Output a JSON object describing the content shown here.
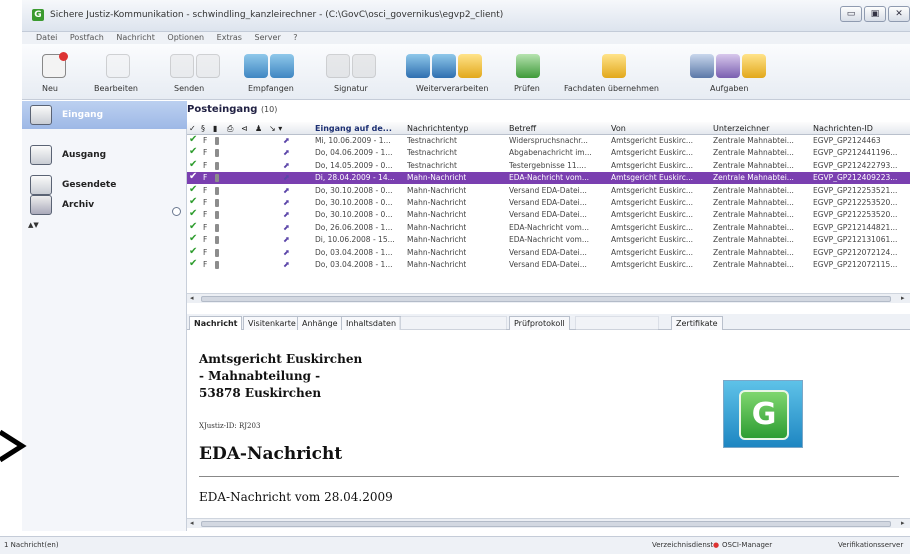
{
  "window": {
    "title": "Sichere Justiz-Kommunikation - schwindling_kanzleirechner - (C:\\GovC\\osci_governikus\\egvp2_client)",
    "buttons": [
      "▭",
      "▣",
      "✕"
    ]
  },
  "menu": [
    "Datei",
    "Postfach",
    "Nachricht",
    "Optionen",
    "Extras",
    "Server",
    "?"
  ],
  "toolbar": {
    "neu": "Neu",
    "bearbeiten": "Bearbeiten",
    "senden": "Senden",
    "empfangen": "Empfangen",
    "signatur": "Signatur",
    "weiterverarbeiten": "Weiterverarbeiten",
    "pruefen": "Prüfen",
    "fachdaten": "Fachdaten übernehmen",
    "aufgaben": "Aufgaben"
  },
  "sidebar": {
    "items": [
      {
        "label": "Eingang"
      },
      {
        "label": "Ausgang"
      },
      {
        "label": "Gesendete"
      },
      {
        "label": "Archiv"
      }
    ],
    "collapse": "▲▼"
  },
  "list": {
    "title": "Posteingang",
    "count": "(10)",
    "columns": {
      "flags": "§",
      "eingang": "Eingang auf de...",
      "typ": "Nachrichtentyp",
      "betreff": "Betreff",
      "von": "Von",
      "unterzeichner": "Unterzeichner",
      "id": "Nachrichten-ID"
    },
    "rows": [
      {
        "f": "F",
        "date": "Mi, 10.06.2009 - 1...",
        "typ": "Testnachricht",
        "betreff": "Widerspruchsnachr...",
        "von": "Amtsgericht Euskirc...",
        "unter": "Zentrale Mahnabtei...",
        "id": "EGVP_GP2124463"
      },
      {
        "f": "F",
        "date": "Do, 04.06.2009 - 1...",
        "typ": "Testnachricht",
        "betreff": "Abgabenachricht im...",
        "von": "Amtsgericht Euskirc...",
        "unter": "Zentrale Mahnabtei...",
        "id": "EGVP_GP212441196..."
      },
      {
        "f": "F",
        "date": "Do, 14.05.2009 - 0...",
        "typ": "Testnachricht",
        "betreff": "Testergebnisse 11....",
        "von": "Amtsgericht Euskirc...",
        "unter": "Zentrale Mahnabtei...",
        "id": "EGVP_GP212422793..."
      },
      {
        "f": "F",
        "date": "Di, 28.04.2009 - 14...",
        "typ": "Mahn-Nachricht",
        "betreff": "EDA-Nachricht vom...",
        "von": "Amtsgericht Euskirc...",
        "unter": "Zentrale Mahnabtei...",
        "id": "EGVP_GP212409223..."
      },
      {
        "f": "F",
        "date": "Do, 30.10.2008 - 0...",
        "typ": "Mahn-Nachricht",
        "betreff": "Versand EDA-Datei...",
        "von": "Amtsgericht Euskirc...",
        "unter": "Zentrale Mahnabtei...",
        "id": "EGVP_GP212253521..."
      },
      {
        "f": "F",
        "date": "Do, 30.10.2008 - 0...",
        "typ": "Mahn-Nachricht",
        "betreff": "Versand EDA-Datei...",
        "von": "Amtsgericht Euskirc...",
        "unter": "Zentrale Mahnabtei...",
        "id": "EGVP_GP212253520..."
      },
      {
        "f": "F",
        "date": "Do, 30.10.2008 - 0...",
        "typ": "Mahn-Nachricht",
        "betreff": "Versand EDA-Datei...",
        "von": "Amtsgericht Euskirc...",
        "unter": "Zentrale Mahnabtei...",
        "id": "EGVP_GP212253520..."
      },
      {
        "f": "F",
        "date": "Do, 26.06.2008 - 1...",
        "typ": "Mahn-Nachricht",
        "betreff": "EDA-Nachricht vom...",
        "von": "Amtsgericht Euskirc...",
        "unter": "Zentrale Mahnabtei...",
        "id": "EGVP_GP212144821..."
      },
      {
        "f": "F",
        "date": "Di, 10.06.2008 - 15...",
        "typ": "Mahn-Nachricht",
        "betreff": "EDA-Nachricht vom...",
        "von": "Amtsgericht Euskirc...",
        "unter": "Zentrale Mahnabtei...",
        "id": "EGVP_GP212131061..."
      },
      {
        "f": "F",
        "date": "Do, 03.04.2008 - 1...",
        "typ": "Mahn-Nachricht",
        "betreff": "Versand EDA-Datei...",
        "von": "Amtsgericht Euskirc...",
        "unter": "Zentrale Mahnabtei...",
        "id": "EGVP_GP212072124..."
      },
      {
        "f": "F",
        "date": "Do, 03.04.2008 - 1...",
        "typ": "Mahn-Nachricht",
        "betreff": "Versand EDA-Datei...",
        "von": "Amtsgericht Euskirc...",
        "unter": "Zentrale Mahnabtei...",
        "id": "EGVP_GP212072115..."
      }
    ]
  },
  "tabs": [
    "Nachricht",
    "Visitenkarte",
    "Anhänge",
    "Inhaltsdaten",
    "Prüfprotokoll",
    "Zertifikate"
  ],
  "preview": {
    "addr1": "Amtsgericht Euskirchen",
    "addr2": "- Mahnabteilung -",
    "addr3": "53878 Euskirchen",
    "small": "XJustiz-ID: RJ203",
    "heading": "EDA-Nachricht",
    "line": "EDA-Nachricht vom 28.04.2009",
    "logo_letter": "G"
  },
  "status": {
    "left": "1 Nachricht(en)",
    "verz": "Verzeichnisdienst",
    "osci": "OSCI-Manager",
    "verif": "Verifikationsserver"
  },
  "colors": {
    "selection": "#7a3fb0",
    "check": "#2f9d2f",
    "logo_green": "#3aa53a"
  }
}
